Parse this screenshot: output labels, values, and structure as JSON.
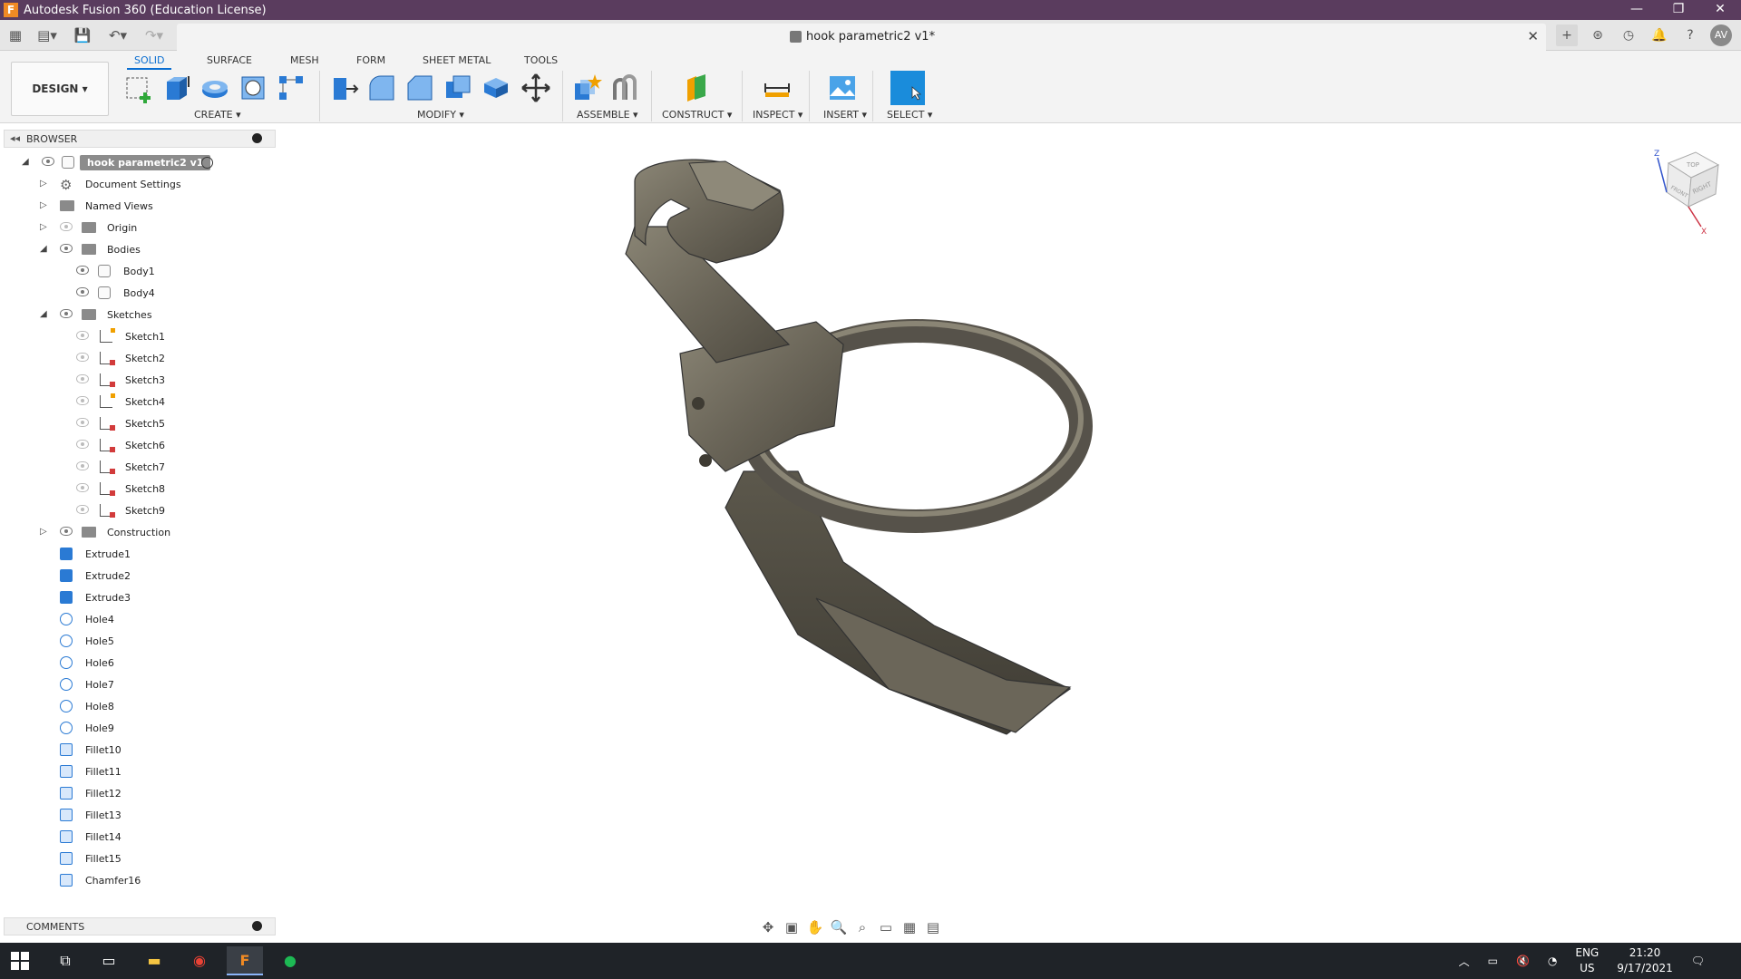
{
  "window": {
    "title": "Autodesk Fusion 360 (Education License)",
    "app_letter": "F",
    "minimize": "—",
    "maximize": "❐",
    "close": "✕"
  },
  "document": {
    "title": "hook parametric2 v1*",
    "close": "✕"
  },
  "toolbar": {
    "design_label": "DESIGN ▾",
    "tabs": [
      "SOLID",
      "SURFACE",
      "MESH",
      "FORM",
      "SHEET METAL",
      "TOOLS"
    ],
    "active_tab": "SOLID",
    "groups": {
      "create": "CREATE ▾",
      "modify": "MODIFY ▾",
      "assemble": "ASSEMBLE ▾",
      "construct": "CONSTRUCT ▾",
      "inspect": "INSPECT ▾",
      "insert": "INSERT ▾",
      "select": "SELECT ▾"
    }
  },
  "user": {
    "initials": "AV"
  },
  "browser": {
    "title": "BROWSER",
    "root": "hook parametric2 v1",
    "items": {
      "document_settings": "Document Settings",
      "named_views": "Named Views",
      "origin": "Origin",
      "bodies": "Bodies",
      "body1": "Body1",
      "body4": "Body4",
      "sketches": "Sketches",
      "sketch1": "Sketch1",
      "sketch2": "Sketch2",
      "sketch3": "Sketch3",
      "sketch4": "Sketch4",
      "sketch5": "Sketch5",
      "sketch6": "Sketch6",
      "sketch7": "Sketch7",
      "sketch8": "Sketch8",
      "sketch9": "Sketch9",
      "construction": "Construction",
      "extrude1": "Extrude1",
      "extrude2": "Extrude2",
      "extrude3": "Extrude3",
      "hole4": "Hole4",
      "hole5": "Hole5",
      "hole6": "Hole6",
      "hole7": "Hole7",
      "hole8": "Hole8",
      "hole9": "Hole9",
      "fillet10": "Fillet10",
      "fillet11": "Fillet11",
      "fillet12": "Fillet12",
      "fillet13": "Fillet13",
      "fillet14": "Fillet14",
      "fillet15": "Fillet15",
      "chamfer16": "Chamfer16"
    }
  },
  "comments": {
    "title": "COMMENTS"
  },
  "viewcube": {
    "top": "TOP",
    "front": "FRONT",
    "right": "RIGHT",
    "z": "Z",
    "x": "X"
  },
  "taskbar": {
    "lang_line1": "ENG",
    "lang_line2": "US",
    "time": "21:20",
    "date": "9/17/2021"
  },
  "colors": {
    "titlebar": "#5a3c5e",
    "accent": "#0a6ed1",
    "model": "#6b6659"
  }
}
